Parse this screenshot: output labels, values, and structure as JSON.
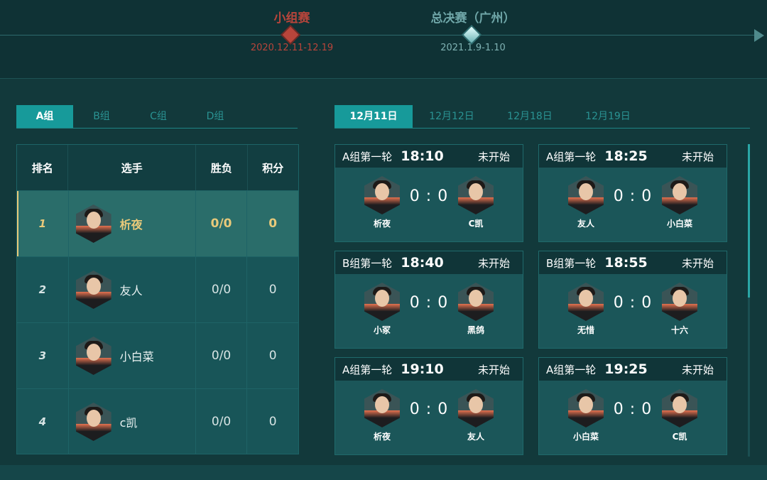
{
  "timeline": {
    "stages": [
      {
        "name": "小组赛",
        "date": "2020.12.11-12.19"
      },
      {
        "name": "总决赛（广州）",
        "date": "2021.1.9-1.10"
      }
    ]
  },
  "group_tabs": [
    "A组",
    "B组",
    "C组",
    "D组"
  ],
  "group_tabs_active": "A组",
  "date_tabs": [
    "12月11日",
    "12月12日",
    "12月18日",
    "12月19日"
  ],
  "date_tabs_active": "12月11日",
  "standings": {
    "headers": {
      "rank": "排名",
      "player": "选手",
      "wl": "胜负",
      "points": "积分"
    },
    "rows": [
      {
        "rank": "1",
        "player": "析夜",
        "wl": "0/0",
        "points": "0"
      },
      {
        "rank": "2",
        "player": "友人",
        "wl": "0/0",
        "points": "0"
      },
      {
        "rank": "3",
        "player": "小白菜",
        "wl": "0/0",
        "points": "0"
      },
      {
        "rank": "4",
        "player": "c凯",
        "wl": "0/0",
        "points": "0"
      }
    ]
  },
  "matches": [
    {
      "round": "A组第一轮",
      "time": "18:10",
      "status": "未开始",
      "score": "0 : 0",
      "p1": "析夜",
      "p2": "C凯"
    },
    {
      "round": "A组第一轮",
      "time": "18:25",
      "status": "未开始",
      "score": "0 : 0",
      "p1": "友人",
      "p2": "小白菜"
    },
    {
      "round": "B组第一轮",
      "time": "18:40",
      "status": "未开始",
      "score": "0 : 0",
      "p1": "小冢",
      "p2": "黑鸽"
    },
    {
      "round": "B组第一轮",
      "time": "18:55",
      "status": "未开始",
      "score": "0 : 0",
      "p1": "无惜",
      "p2": "十六"
    },
    {
      "round": "A组第一轮",
      "time": "19:10",
      "status": "未开始",
      "score": "0 : 0",
      "p1": "析夜",
      "p2": "友人"
    },
    {
      "round": "A组第一轮",
      "time": "19:25",
      "status": "未开始",
      "score": "0 : 0",
      "p1": "小白菜",
      "p2": "C凯"
    }
  ],
  "colors": {
    "accent": "#179a9a",
    "group_stage": "#b8453b",
    "highlight": "#e8c97a"
  }
}
